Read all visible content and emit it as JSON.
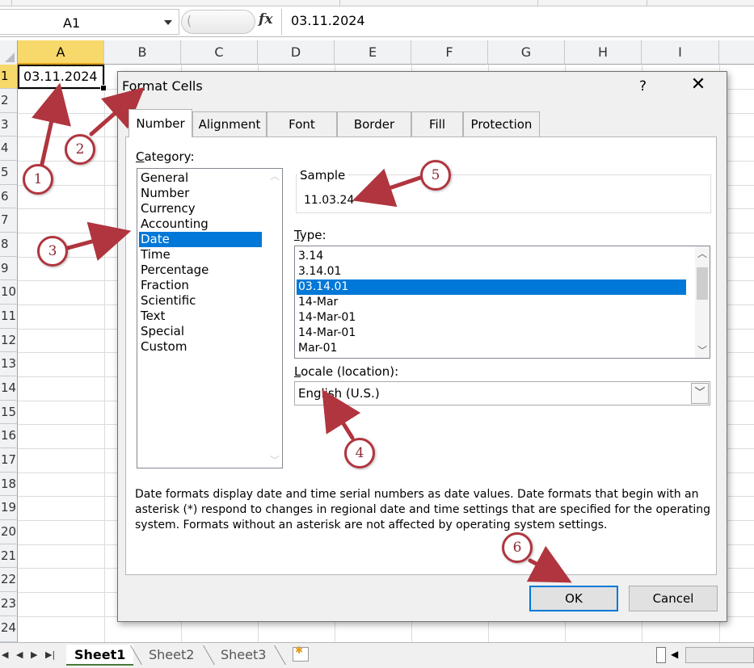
{
  "formula_bar": {
    "name_box": "A1",
    "fx": "fx",
    "value": "03.11.2024"
  },
  "columns": [
    "A",
    "B",
    "C",
    "D",
    "E",
    "F",
    "G",
    "H",
    "I"
  ],
  "rows": [
    "1",
    "2",
    "3",
    "4",
    "5",
    "6",
    "7",
    "8",
    "9",
    "10",
    "11",
    "12",
    "13",
    "14",
    "15",
    "16",
    "17",
    "18",
    "19",
    "20",
    "21",
    "22",
    "23",
    "24"
  ],
  "cell_a1": "03.11.2024",
  "sheets": {
    "tabs": [
      "Sheet1",
      "Sheet2",
      "Sheet3"
    ],
    "active": "Sheet1"
  },
  "dialog": {
    "title": "Format Cells",
    "help": "?",
    "close": "✕",
    "tabs": [
      "Number",
      "Alignment",
      "Font",
      "Border",
      "Fill",
      "Protection"
    ],
    "category_label_prefix": "C",
    "category_label_rest": "ategory:",
    "categories": [
      "General",
      "Number",
      "Currency",
      "Accounting",
      "Date",
      "Time",
      "Percentage",
      "Fraction",
      "Scientific",
      "Text",
      "Special",
      "Custom"
    ],
    "selected_category": "Date",
    "sample_label": "Sample",
    "sample_value": "11.03.24",
    "type_label_prefix": "T",
    "type_label_rest": "ype:",
    "types": [
      "3.14",
      "3.14.01",
      "03.14.01",
      "14-Mar",
      "14-Mar-01",
      "14-Mar-01",
      "Mar-01"
    ],
    "selected_type": "03.14.01",
    "locale_label_prefix": "L",
    "locale_label_rest": "ocale (location):",
    "locale_value": "English (U.S.)",
    "description": "Date formats display date and time serial numbers as date values.  Date formats that begin with an asterisk (*) respond to changes in regional date and time settings that are specified for the operating system. Formats without an asterisk are not affected by operating system settings.",
    "ok": "OK",
    "cancel": "Cancel"
  },
  "annotations": [
    "1",
    "2",
    "3",
    "4",
    "5",
    "6"
  ],
  "colors": {
    "annotation": "#b0353e",
    "selection": "#0078d7",
    "header_selected": "#f7d86b"
  }
}
